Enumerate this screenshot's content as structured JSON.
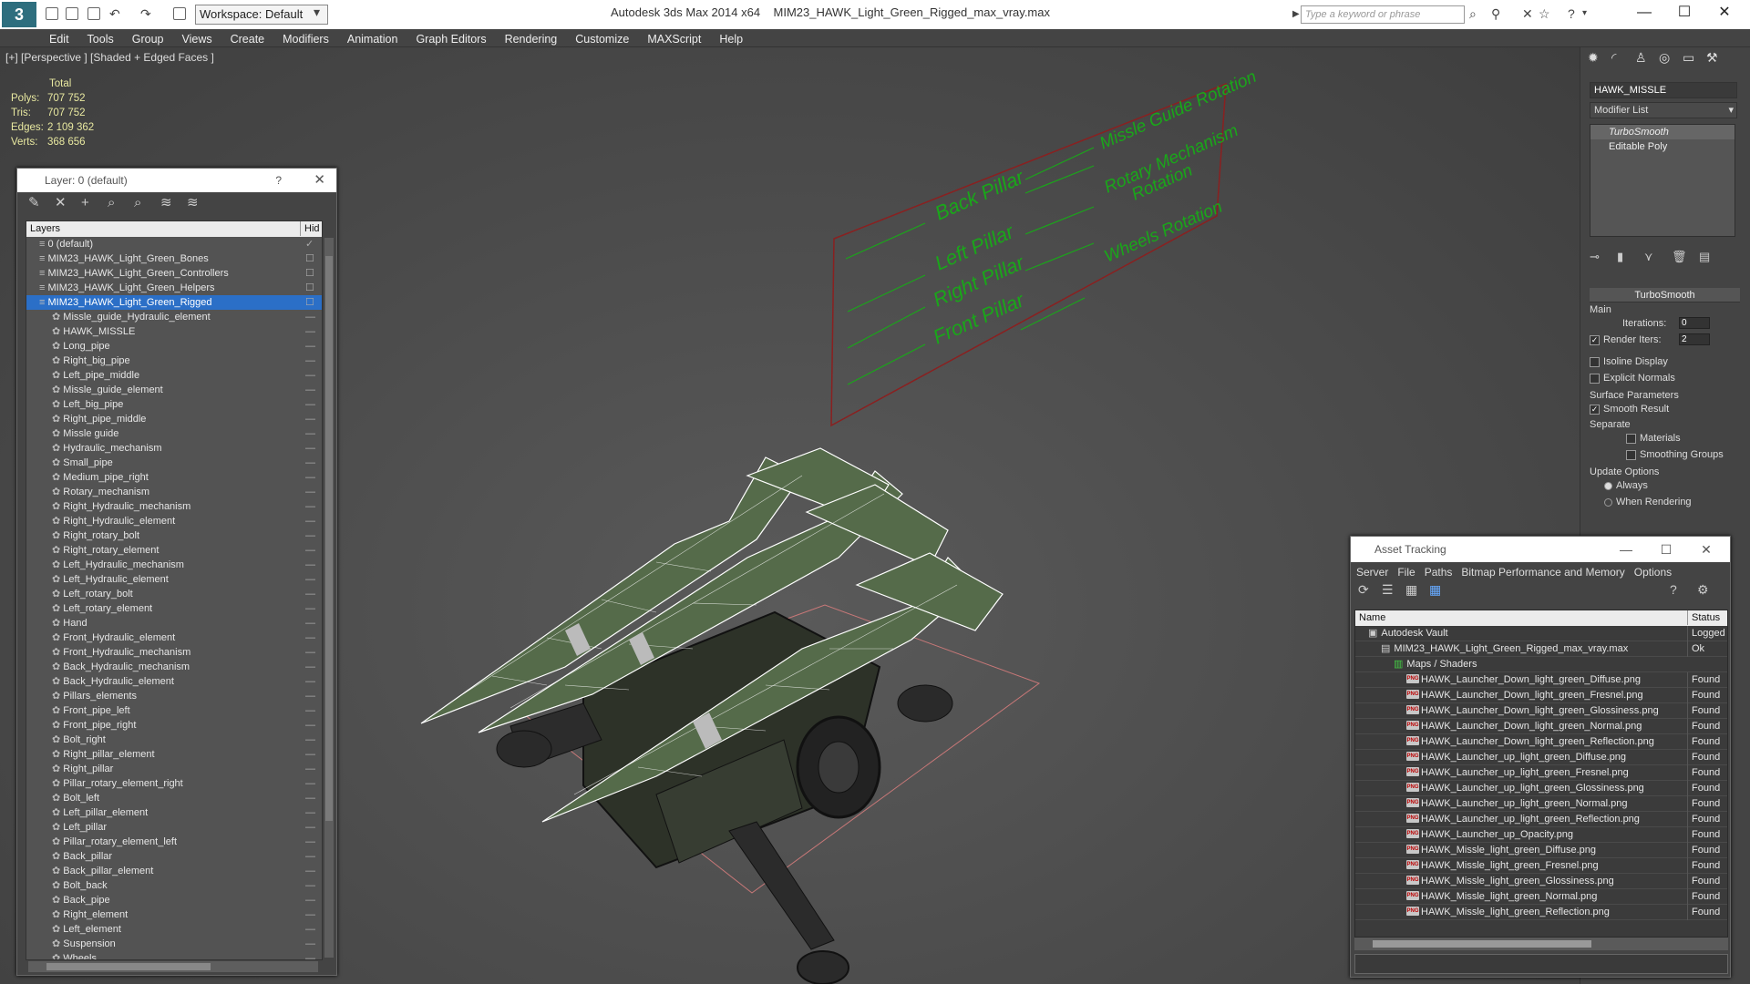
{
  "titlebar": {
    "app": "Autodesk 3ds Max  2014 x64",
    "file": "MIM23_HAWK_Light_Green_Rigged_max_vray.max",
    "workspace": "Workspace: Default",
    "search_placeholder": "Type a keyword or phrase"
  },
  "menu": [
    "Edit",
    "Tools",
    "Group",
    "Views",
    "Create",
    "Modifiers",
    "Animation",
    "Graph Editors",
    "Rendering",
    "Customize",
    "MAXScript",
    "Help"
  ],
  "viewport": {
    "label": "[+] [Perspective ] [Shaded + Edged Faces ]",
    "stats": {
      "header": "Total",
      "rows": [
        {
          "label": "Polys:",
          "value": "707 752"
        },
        {
          "label": "Tris:",
          "value": "707 752"
        },
        {
          "label": "Edges:",
          "value": "2 109 362"
        },
        {
          "label": "Verts:",
          "value": "368 656"
        }
      ]
    },
    "rig_labels": {
      "back_pillar": "Back Pillar",
      "left_pillar": "Left Pillar",
      "right_pillar": "Right Pillar",
      "front_pillar": "Front Pillar",
      "missle_guide": "Missle Guide Rotation",
      "rotary": "Rotary Mechanism",
      "rotation": "Rotation",
      "wheels": "Wheels Rotation"
    }
  },
  "layer_panel": {
    "title": "Layer: 0 (default)",
    "help": "?",
    "col_layers": "Layers",
    "col_hide": "Hid",
    "layers": [
      {
        "name": "0 (default)",
        "indent": 1,
        "selected": false
      },
      {
        "name": "MIM23_HAWK_Light_Green_Bones",
        "indent": 1,
        "selected": false
      },
      {
        "name": "MIM23_HAWK_Light_Green_Controllers",
        "indent": 1,
        "selected": false
      },
      {
        "name": "MIM23_HAWK_Light_Green_Helpers",
        "indent": 1,
        "selected": false
      },
      {
        "name": "MIM23_HAWK_Light_Green_Rigged",
        "indent": 1,
        "selected": true
      },
      {
        "name": "Missle_guide_Hydraulic_element",
        "indent": 2
      },
      {
        "name": "HAWK_MISSLE",
        "indent": 2
      },
      {
        "name": "Long_pipe",
        "indent": 2
      },
      {
        "name": "Right_big_pipe",
        "indent": 2
      },
      {
        "name": "Left_pipe_middle",
        "indent": 2
      },
      {
        "name": "Missle_guide_element",
        "indent": 2
      },
      {
        "name": "Left_big_pipe",
        "indent": 2
      },
      {
        "name": "Right_pipe_middle",
        "indent": 2
      },
      {
        "name": "Missle guide",
        "indent": 2
      },
      {
        "name": "Hydraulic_mechanism",
        "indent": 2
      },
      {
        "name": "Small_pipe",
        "indent": 2
      },
      {
        "name": "Medium_pipe_right",
        "indent": 2
      },
      {
        "name": "Rotary_mechanism",
        "indent": 2
      },
      {
        "name": "Right_Hydraulic_mechanism",
        "indent": 2
      },
      {
        "name": "Right_Hydraulic_element",
        "indent": 2
      },
      {
        "name": "Right_rotary_bolt",
        "indent": 2
      },
      {
        "name": "Right_rotary_element",
        "indent": 2
      },
      {
        "name": "Left_Hydraulic_mechanism",
        "indent": 2
      },
      {
        "name": "Left_Hydraulic_element",
        "indent": 2
      },
      {
        "name": "Left_rotary_bolt",
        "indent": 2
      },
      {
        "name": "Left_rotary_element",
        "indent": 2
      },
      {
        "name": "Hand",
        "indent": 2
      },
      {
        "name": "Front_Hydraulic_element",
        "indent": 2
      },
      {
        "name": "Front_Hydraulic_mechanism",
        "indent": 2
      },
      {
        "name": "Back_Hydraulic_mechanism",
        "indent": 2
      },
      {
        "name": "Back_Hydraulic_element",
        "indent": 2
      },
      {
        "name": "Pillars_elements",
        "indent": 2
      },
      {
        "name": "Front_pipe_left",
        "indent": 2
      },
      {
        "name": "Front_pipe_right",
        "indent": 2
      },
      {
        "name": "Bolt_right",
        "indent": 2
      },
      {
        "name": "Right_pillar_element",
        "indent": 2
      },
      {
        "name": "Right_pillar",
        "indent": 2
      },
      {
        "name": "Pillar_rotary_element_right",
        "indent": 2
      },
      {
        "name": "Bolt_left",
        "indent": 2
      },
      {
        "name": "Left_pillar_element",
        "indent": 2
      },
      {
        "name": "Left_pillar",
        "indent": 2
      },
      {
        "name": "Pillar_rotary_element_left",
        "indent": 2
      },
      {
        "name": "Back_pillar",
        "indent": 2
      },
      {
        "name": "Back_pillar_element",
        "indent": 2
      },
      {
        "name": "Bolt_back",
        "indent": 2
      },
      {
        "name": "Back_pipe",
        "indent": 2
      },
      {
        "name": "Right_element",
        "indent": 2
      },
      {
        "name": "Left_element",
        "indent": 2
      },
      {
        "name": "Suspension",
        "indent": 2
      },
      {
        "name": "Wheels",
        "indent": 2
      }
    ]
  },
  "command_panel": {
    "object_name": "HAWK_MISSLE",
    "modifier_list": "Modifier List",
    "stack": [
      "TurboSmooth",
      "Editable Poly"
    ],
    "rollout_title": "TurboSmooth",
    "main_group": "Main",
    "iterations_label": "Iterations:",
    "iterations_value": "0",
    "render_iters_label": "Render Iters:",
    "render_iters_value": "2",
    "isoline": "Isoline Display",
    "explicit_normals": "Explicit Normals",
    "surface_group": "Surface Parameters",
    "smooth_result": "Smooth Result",
    "separate": "Separate",
    "materials": "Materials",
    "smoothing_groups": "Smoothing Groups",
    "update_group": "Update Options",
    "always": "Always",
    "when_rendering": "When Rendering"
  },
  "asset_tracking": {
    "title": "Asset Tracking",
    "menu": [
      "Server",
      "File",
      "Paths",
      "Bitmap Performance and Memory",
      "Options"
    ],
    "col_name": "Name",
    "col_status": "Status",
    "rows": [
      {
        "name": "Autodesk Vault",
        "status": "Logged",
        "level": 0,
        "type": "vault"
      },
      {
        "name": "MIM23_HAWK_Light_Green_Rigged_max_vray.max",
        "status": "Ok",
        "level": 1,
        "type": "max"
      },
      {
        "name": "Maps / Shaders",
        "status": "",
        "level": 2,
        "type": "maps"
      },
      {
        "name": "HAWK_Launcher_Down_light_green_Diffuse.png",
        "status": "Found",
        "level": 3,
        "type": "png"
      },
      {
        "name": "HAWK_Launcher_Down_light_green_Fresnel.png",
        "status": "Found",
        "level": 3,
        "type": "png"
      },
      {
        "name": "HAWK_Launcher_Down_light_green_Glossiness.png",
        "status": "Found",
        "level": 3,
        "type": "png"
      },
      {
        "name": "HAWK_Launcher_Down_light_green_Normal.png",
        "status": "Found",
        "level": 3,
        "type": "png"
      },
      {
        "name": "HAWK_Launcher_Down_light_green_Reflection.png",
        "status": "Found",
        "level": 3,
        "type": "png"
      },
      {
        "name": "HAWK_Launcher_up_light_green_Diffuse.png",
        "status": "Found",
        "level": 3,
        "type": "png"
      },
      {
        "name": "HAWK_Launcher_up_light_green_Fresnel.png",
        "status": "Found",
        "level": 3,
        "type": "png"
      },
      {
        "name": "HAWK_Launcher_up_light_green_Glossiness.png",
        "status": "Found",
        "level": 3,
        "type": "png"
      },
      {
        "name": "HAWK_Launcher_up_light_green_Normal.png",
        "status": "Found",
        "level": 3,
        "type": "png"
      },
      {
        "name": "HAWK_Launcher_up_light_green_Reflection.png",
        "status": "Found",
        "level": 3,
        "type": "png"
      },
      {
        "name": "HAWK_Launcher_up_Opacity.png",
        "status": "Found",
        "level": 3,
        "type": "png"
      },
      {
        "name": "HAWK_Missle_light_green_Diffuse.png",
        "status": "Found",
        "level": 3,
        "type": "png"
      },
      {
        "name": "HAWK_Missle_light_green_Fresnel.png",
        "status": "Found",
        "level": 3,
        "type": "png"
      },
      {
        "name": "HAWK_Missle_light_green_Glossiness.png",
        "status": "Found",
        "level": 3,
        "type": "png"
      },
      {
        "name": "HAWK_Missle_light_green_Normal.png",
        "status": "Found",
        "level": 3,
        "type": "png"
      },
      {
        "name": "HAWK_Missle_light_green_Reflection.png",
        "status": "Found",
        "level": 3,
        "type": "png"
      }
    ]
  },
  "colors": {
    "selection": "#2b6fc7",
    "rig_green": "#1aa61a",
    "rig_frame": "#a02020",
    "wire": "#ffffff",
    "mesh": "#556b4a"
  },
  "icons": {
    "app_logo": "3ds-max-logo",
    "search": "binoculars-icon",
    "help": "help-icon"
  }
}
